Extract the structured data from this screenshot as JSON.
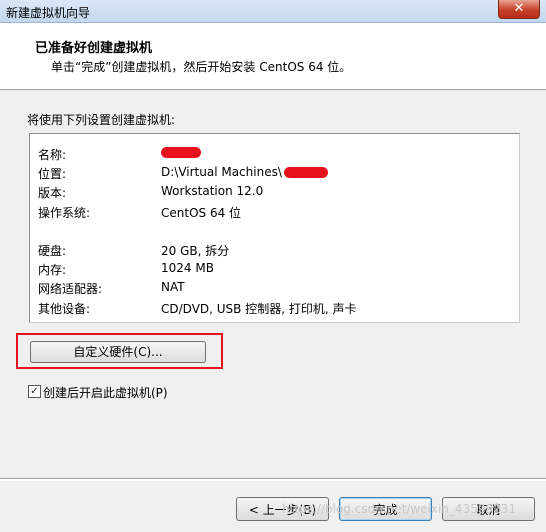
{
  "window": {
    "title": "新建虚拟机向导",
    "close_label": "✕"
  },
  "header": {
    "title": "已准备好创建虚拟机",
    "subtitle": "单击“完成”创建虚拟机，然后开始安装 CentOS 64 位。"
  },
  "intro_text": "将使用下列设置创建虚拟机:",
  "summary": {
    "rows": [
      {
        "key": "名称:",
        "value": "",
        "redacted": true
      },
      {
        "key": "位置:",
        "value": "D:\\Virtual Machines\\",
        "redacted": true
      },
      {
        "key": "版本:",
        "value": "Workstation 12.0"
      },
      {
        "key": "操作系统:",
        "value": "CentOS 64 位"
      },
      {
        "key": "硬盘:",
        "value": "20 GB, 拆分"
      },
      {
        "key": "内存:",
        "value": "1024 MB"
      },
      {
        "key": "网络适配器:",
        "value": "NAT"
      },
      {
        "key": "其他设备:",
        "value": "CD/DVD, USB 控制器, 打印机, 声卡"
      }
    ]
  },
  "customize_button": "自定义硬件(C)...",
  "power_on_checkbox": {
    "label": "创建后开启此虚拟机(P)",
    "checked": true
  },
  "buttons": {
    "back": "< 上一步(B)",
    "finish": "完成",
    "cancel": "取消"
  },
  "watermark": "https://blog.csdn.net/weixin_43599231",
  "colors": {
    "highlight": "#e8121e",
    "redaction": "#e8121e"
  }
}
